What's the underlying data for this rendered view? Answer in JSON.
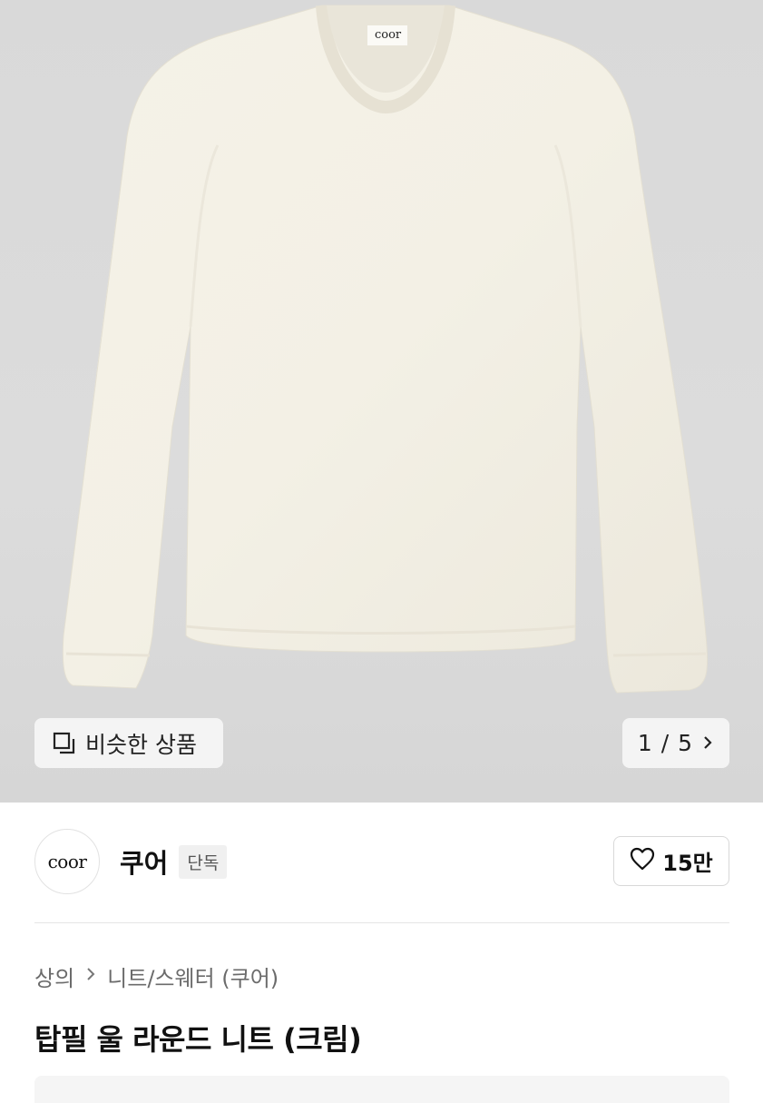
{
  "hero": {
    "image_label": "coor",
    "similar_button": "비슷한 상품",
    "pager": {
      "current": "1",
      "separator": "/",
      "total": "5"
    }
  },
  "brand": {
    "logo_text": "coor",
    "name": "쿠어",
    "badge": "단독",
    "like_count": "15만"
  },
  "breadcrumb": {
    "category": "상의",
    "subcategory": "니트/스웨터 (쿠어)"
  },
  "product": {
    "title": "탑필 울 라운드 니트 (크림)"
  },
  "colors": {
    "background": "#ffffff",
    "hero_bg": "#dadada",
    "sweater": "#f3f0e6"
  }
}
